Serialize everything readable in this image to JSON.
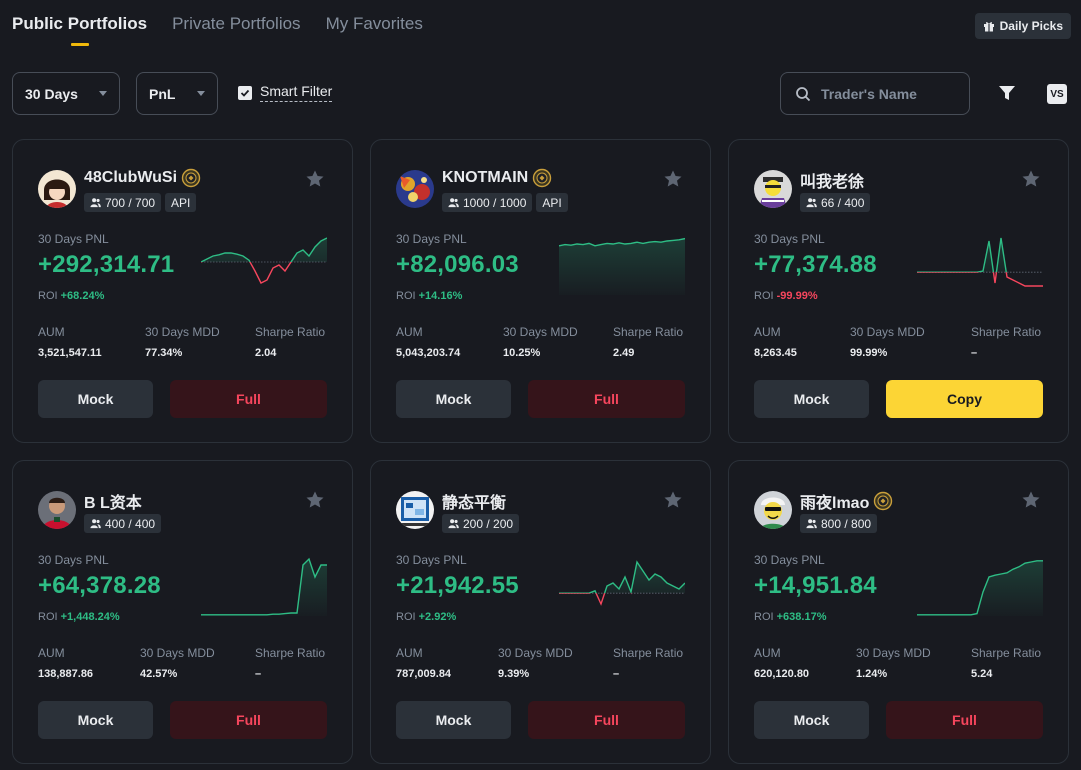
{
  "tabs": [
    {
      "label": "Public Portfolios",
      "active": true
    },
    {
      "label": "Private Portfolios",
      "active": false
    },
    {
      "label": "My Favorites",
      "active": false
    }
  ],
  "daily_picks": "Daily Picks",
  "filters": {
    "period": "30 Days",
    "sort": "PnL",
    "smart_filter": "Smart Filter",
    "smart_checked": true,
    "search_placeholder": "Trader's Name",
    "vs": "VS"
  },
  "colors": {
    "positive": "#2ebd85",
    "negative": "#f6465d",
    "accent": "#f0b90b",
    "copy": "#fcd535"
  },
  "cards": [
    {
      "name": "48ClubWuSi",
      "badge": true,
      "copiers": "700 / 700",
      "api": "API",
      "pnl_label": "30 Days PNL",
      "pnl": "+292,314.71",
      "roi_label": "ROI",
      "roi": "+68.24%",
      "roi_sign": "pos",
      "aum_label": "AUM",
      "aum": "3,521,547.11",
      "mdd_label": "30 Days MDD",
      "mdd": "77.34%",
      "sharpe_label": "Sharpe Ratio",
      "sharpe": "2.04",
      "mock": "Mock",
      "action": "Full",
      "action_type": "full",
      "sparkline": [
        0.45,
        0.4,
        0.35,
        0.33,
        0.3,
        0.3,
        0.32,
        0.35,
        0.42,
        0.6,
        0.8,
        0.75,
        0.55,
        0.5,
        0.6,
        0.45,
        0.3,
        0.25,
        0.35,
        0.2,
        0.1,
        0.05
      ],
      "baseline": 0.45
    },
    {
      "name": "KNOTMAIN",
      "badge": true,
      "copiers": "1000 / 1000",
      "api": "API",
      "pnl_label": "30 Days PNL",
      "pnl": "+82,096.03",
      "roi_label": "ROI",
      "roi": "+14.16%",
      "roi_sign": "pos",
      "aum_label": "AUM",
      "aum": "5,043,203.74",
      "mdd_label": "30 Days MDD",
      "mdd": "10.25%",
      "sharpe_label": "Sharpe Ratio",
      "sharpe": "2.49",
      "mock": "Mock",
      "action": "Full",
      "action_type": "full",
      "sparkline": [
        0.18,
        0.16,
        0.17,
        0.15,
        0.16,
        0.14,
        0.18,
        0.16,
        0.14,
        0.15,
        0.13,
        0.15,
        0.14,
        0.12,
        0.14,
        0.12,
        0.11,
        0.12,
        0.1,
        0.09,
        0.08,
        0.06
      ],
      "baseline": 1.0
    },
    {
      "name": "叫我老徐",
      "badge": false,
      "copiers": "66 / 400",
      "api": "",
      "pnl_label": "30 Days PNL",
      "pnl": "+77,374.88",
      "roi_label": "ROI",
      "roi": "-99.99%",
      "roi_sign": "neg",
      "aum_label": "AUM",
      "aum": "8,263.45",
      "mdd_label": "30 Days MDD",
      "mdd": "99.99%",
      "sharpe_label": "Sharpe Ratio",
      "sharpe": "–",
      "mock": "Mock",
      "action": "Copy",
      "action_type": "copy",
      "sparkline": [
        0.62,
        0.62,
        0.62,
        0.62,
        0.62,
        0.62,
        0.62,
        0.62,
        0.62,
        0.62,
        0.62,
        0.6,
        0.1,
        0.8,
        0.05,
        0.7,
        0.75,
        0.8,
        0.85,
        0.85,
        0.85,
        0.85
      ],
      "baseline": 0.62
    },
    {
      "name": "B L资本",
      "badge": false,
      "copiers": "400 / 400",
      "api": "",
      "pnl_label": "30 Days PNL",
      "pnl": "+64,378.28",
      "roi_label": "ROI",
      "roi": "+1,448.24%",
      "roi_sign": "pos",
      "aum_label": "AUM",
      "aum": "138,887.86",
      "mdd_label": "30 Days MDD",
      "mdd": "42.57%",
      "sharpe_label": "Sharpe Ratio",
      "sharpe": "–",
      "mock": "Mock",
      "action": "Full",
      "action_type": "full",
      "sparkline": [
        0.98,
        0.98,
        0.98,
        0.98,
        0.98,
        0.98,
        0.98,
        0.98,
        0.98,
        0.98,
        0.98,
        0.98,
        0.97,
        0.97,
        0.96,
        0.95,
        0.95,
        0.15,
        0.05,
        0.35,
        0.15,
        0.15
      ],
      "baseline": 1.0
    },
    {
      "name": "静态平衡",
      "badge": false,
      "copiers": "200 / 200",
      "api": "",
      "pnl_label": "30 Days PNL",
      "pnl": "+21,942.55",
      "roi_label": "ROI",
      "roi": "+2.92%",
      "roi_sign": "pos",
      "aum_label": "AUM",
      "aum": "787,009.84",
      "mdd_label": "30 Days MDD",
      "mdd": "9.39%",
      "sharpe_label": "Sharpe Ratio",
      "sharpe": "–",
      "mock": "Mock",
      "action": "Full",
      "action_type": "full",
      "sparkline": [
        0.62,
        0.62,
        0.62,
        0.62,
        0.62,
        0.62,
        0.58,
        0.8,
        0.5,
        0.45,
        0.55,
        0.35,
        0.6,
        0.1,
        0.25,
        0.4,
        0.3,
        0.35,
        0.45,
        0.5,
        0.55,
        0.45
      ],
      "baseline": 0.62
    },
    {
      "name": "雨夜lmao",
      "badge": true,
      "copiers": "800 / 800",
      "api": "",
      "pnl_label": "30 Days PNL",
      "pnl": "+14,951.84",
      "roi_label": "ROI",
      "roi": "+638.17%",
      "roi_sign": "pos",
      "aum_label": "AUM",
      "aum": "620,120.80",
      "mdd_label": "30 Days MDD",
      "mdd": "1.24%",
      "sharpe_label": "Sharpe Ratio",
      "sharpe": "5.24",
      "mock": "Mock",
      "action": "Full",
      "action_type": "full",
      "sparkline": [
        0.98,
        0.98,
        0.98,
        0.98,
        0.98,
        0.98,
        0.98,
        0.98,
        0.98,
        0.98,
        0.96,
        0.6,
        0.35,
        0.32,
        0.3,
        0.28,
        0.22,
        0.18,
        0.12,
        0.1,
        0.08,
        0.08
      ],
      "baseline": 1.0
    }
  ]
}
